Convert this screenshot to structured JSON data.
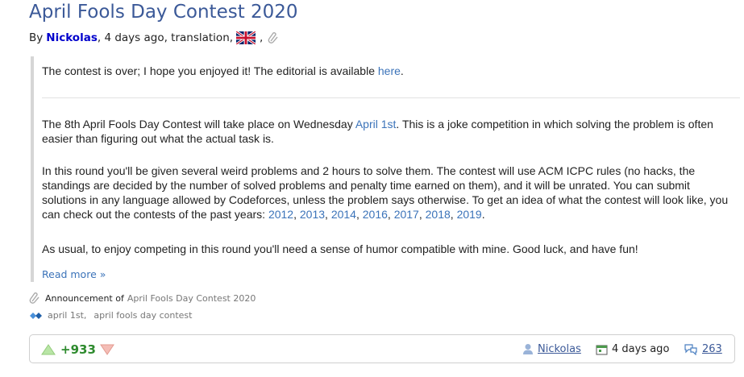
{
  "post": {
    "title": "April Fools Day Contest 2020",
    "by_label": "By",
    "author": "Nickolas",
    "time": ", 4 days ago, translation,",
    "notice_text": "The contest is over; I hope you enjoyed it! The editorial is available ",
    "notice_link": "here",
    "notice_end": ".",
    "p1_a": "The 8th April Fools Day Contest will take place on Wednesday ",
    "p1_link": "April 1st",
    "p1_b": ". This is a joke competition in which solving the problem is often easier than figuring out what the actual task is.",
    "p2_a": "In this round you'll be given several weird problems and 2 hours to solve them. The contest will use ACM ICPC rules (no hacks, the standings are decided by the number of solved problems and penalty time earned on them), and it will be unrated. You can submit solutions in any language allowed by Codeforces, unless the problem says otherwise. To get an idea of what the contest will look like, you can check out the contests of the past years: ",
    "years": [
      "2012",
      "2013",
      "2014",
      "2016",
      "2017",
      "2018",
      "2019"
    ],
    "p2_end": ".",
    "p3": "As usual, to enjoy competing in this round you'll need a sense of humor compatible with mine. Good luck, and have fun!",
    "read_more": "Read more »"
  },
  "meta": {
    "announcement_label": "Announcement of",
    "announcement_link": "April Fools Day Contest 2020",
    "tags": [
      "april 1st",
      "april fools day contest"
    ]
  },
  "footer": {
    "rating": "+933",
    "author": "Nickolas",
    "time": "4 days ago",
    "comments": "263"
  },
  "colors": {
    "title": "#3b5998",
    "link": "#3b73b9",
    "rating": "#2e8b2e"
  },
  "icons": [
    "uk-flag-icon",
    "paperclip-icon",
    "tag-icon",
    "vote-up-icon",
    "vote-down-icon",
    "user-icon",
    "calendar-icon",
    "comments-icon"
  ]
}
